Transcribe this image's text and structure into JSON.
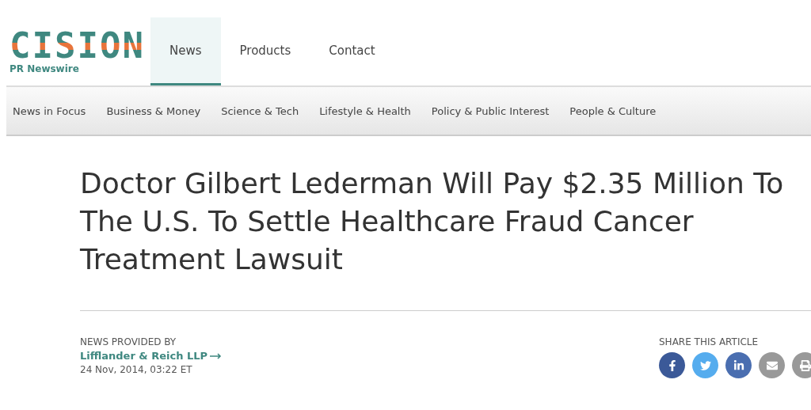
{
  "logo": {
    "wordmark": "CISION",
    "tagline": "PR Newswire"
  },
  "main_nav": [
    {
      "label": "News",
      "selected": true
    },
    {
      "label": "Products",
      "selected": false
    },
    {
      "label": "Contact",
      "selected": false
    }
  ],
  "sub_nav": [
    "News in Focus",
    "Business & Money",
    "Science & Tech",
    "Lifestyle & Health",
    "Policy & Public Interest",
    "People & Culture"
  ],
  "article": {
    "title": "Doctor Gilbert Lederman Will Pay $2.35 Million To The U.S. To Settle Healthcare Fraud Cancer Treatment Lawsuit",
    "provided_by_label": "NEWS PROVIDED BY",
    "provider": "Lifflander & Reich LLP",
    "date": "24 Nov, 2014, 03:22 ET"
  },
  "share": {
    "label": "SHARE THIS ARTICLE",
    "buttons": [
      {
        "kind": "facebook",
        "color": "#3b5998"
      },
      {
        "kind": "twitter",
        "color": "#55acee"
      },
      {
        "kind": "linkedin",
        "color": "#4a6eb0"
      },
      {
        "kind": "email",
        "color": "#999999"
      },
      {
        "kind": "print",
        "color": "#999999"
      }
    ]
  }
}
